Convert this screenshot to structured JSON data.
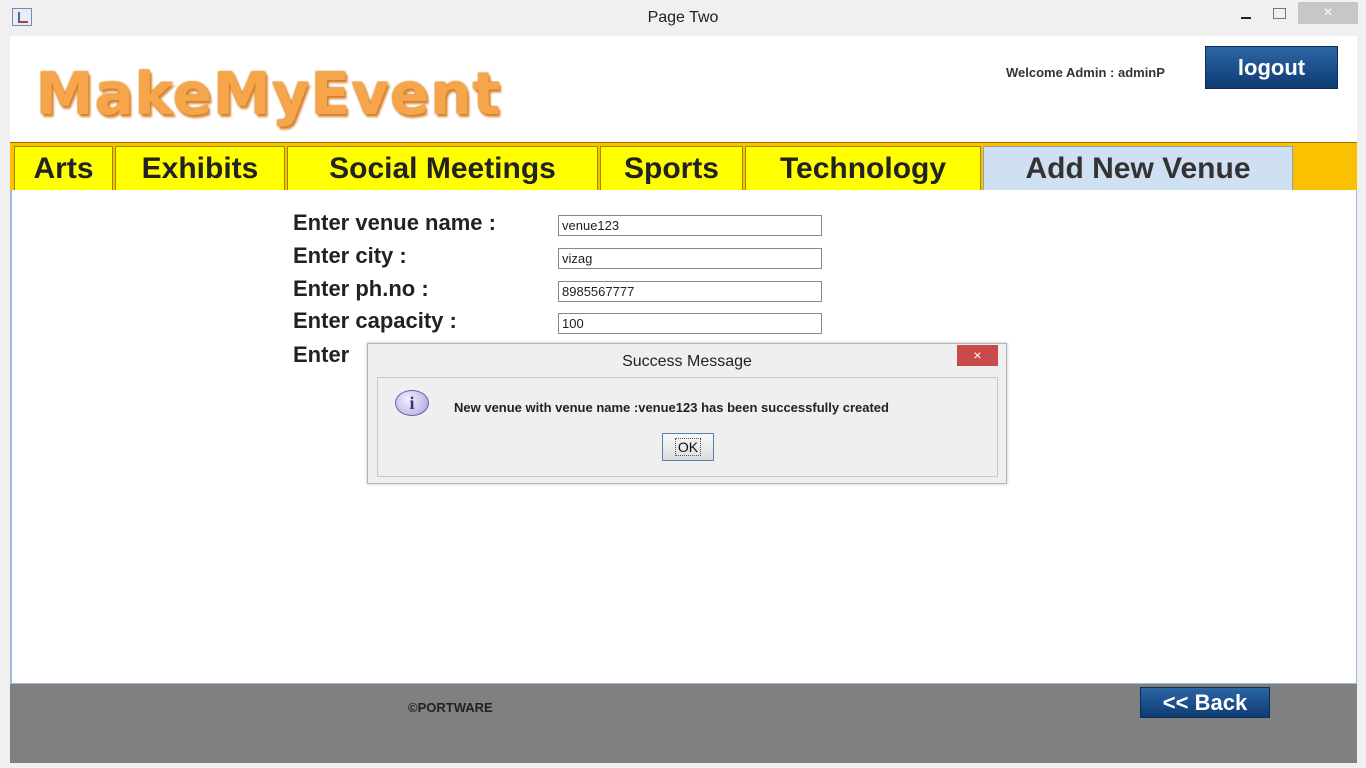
{
  "window": {
    "title": "Page Two",
    "minimize": "–",
    "maximize": "",
    "close": "×"
  },
  "header": {
    "logo": "MakeMyEvent",
    "welcome": "Welcome Admin : adminP",
    "logout_label": "logout"
  },
  "tabs": [
    {
      "label": "Arts",
      "active": false
    },
    {
      "label": "Exhibits",
      "active": false
    },
    {
      "label": "Social Meetings",
      "active": false
    },
    {
      "label": "Sports",
      "active": false
    },
    {
      "label": "Technology",
      "active": false
    },
    {
      "label": "Add New Venue",
      "active": true
    }
  ],
  "form": {
    "venue_name_label": "Enter venue name :",
    "venue_name_value": "venue123",
    "city_label": "Enter city :",
    "city_value": "vizag",
    "phone_label": "Enter ph.no :",
    "phone_value": "8985567777",
    "capacity_label": "Enter capacity :",
    "capacity_value": "100",
    "partial_label": "Enter"
  },
  "footer": {
    "copyright": "©PORTWARE",
    "back_label": "<< Back"
  },
  "dialog": {
    "title": "Success Message",
    "close": "×",
    "icon": "info-icon",
    "icon_glyph": "i",
    "message": "New venue with venue name :venue123 has been successfully created",
    "ok_label": "OK"
  },
  "colors": {
    "tab_bar": "#fbc000",
    "tab": "#ffff00",
    "tab_active": "#cfe0f2",
    "button": "#1a4b86",
    "footer": "#808080",
    "logo": "#f7a54a"
  }
}
